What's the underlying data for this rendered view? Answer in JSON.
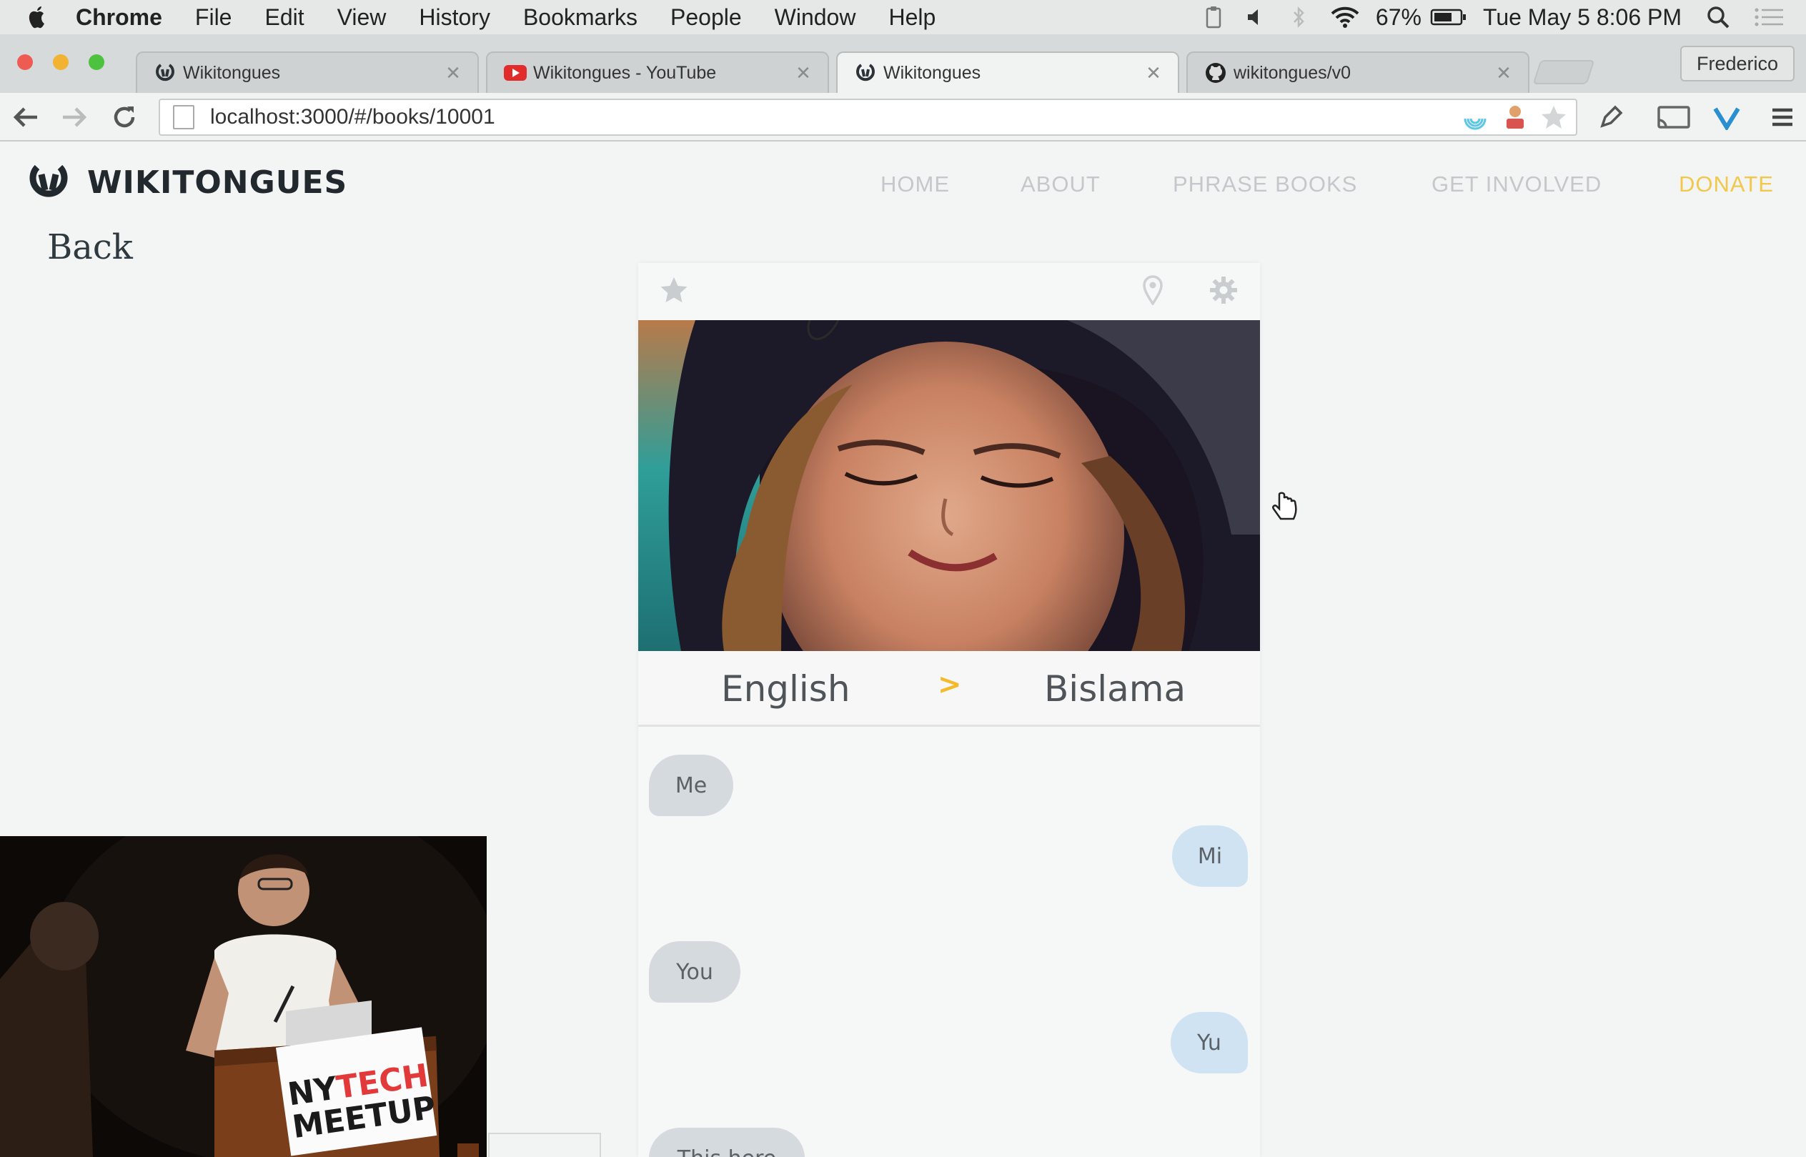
{
  "menubar": {
    "app_name": "Chrome",
    "items": [
      "File",
      "Edit",
      "View",
      "History",
      "Bookmarks",
      "People",
      "Window",
      "Help"
    ],
    "battery": "67%",
    "datetime": "Tue May 5  8:06 PM"
  },
  "browser": {
    "tabs": [
      {
        "title": "Wikitongues",
        "favicon": "wikitongues-icon"
      },
      {
        "title": "Wikitongues - YouTube",
        "favicon": "youtube-icon"
      },
      {
        "title": "Wikitongues",
        "favicon": "wikitongues-icon"
      },
      {
        "title": "wikitongues/v0",
        "favicon": "github-icon"
      }
    ],
    "active_tab": 2,
    "profile": "Frederico",
    "url": "localhost:3000/#/books/10001"
  },
  "site": {
    "logo_text": "WIKITONGUES",
    "nav": [
      "HOME",
      "ABOUT",
      "PHRASE BOOKS",
      "GET INVOLVED",
      "DONATE"
    ],
    "back_label": "Back"
  },
  "phrasebook": {
    "source_language": "English",
    "arrow": ">",
    "target_language": "Bislama",
    "phrases": [
      {
        "source": "Me",
        "target": "Mi"
      },
      {
        "source": "You",
        "target": "Yu"
      },
      {
        "source": "This here",
        "target": ""
      }
    ]
  },
  "video_inset": {
    "sign_line1_a": "NY",
    "sign_line1_b": "TECH",
    "sign_line2": "MEETUP"
  },
  "colors": {
    "accent_yellow": "#f3bb2b",
    "donate": "#f1c84a",
    "bubble_source": "#d5dade",
    "bubble_target": "#cfe3f3"
  }
}
